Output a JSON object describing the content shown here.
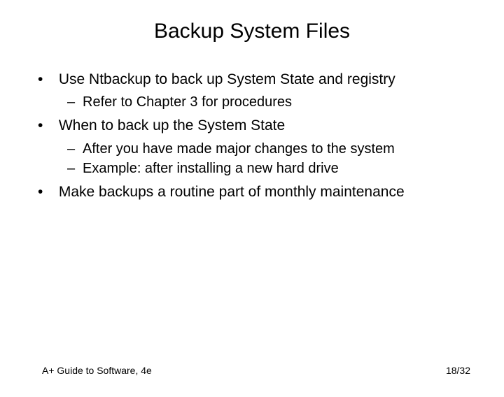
{
  "title": "Backup System Files",
  "bullets": {
    "b1": "Use Ntbackup to back up System State and registry",
    "b1_sub1": "Refer to Chapter 3 for procedures",
    "b2": "When to back up the System State",
    "b2_sub1": "After you have made major changes to the system",
    "b2_sub2": "Example: after installing a new hard drive",
    "b3": "Make backups a routine part of monthly maintenance"
  },
  "footer": {
    "left": "A+ Guide to Software, 4e",
    "right": "18/32"
  }
}
